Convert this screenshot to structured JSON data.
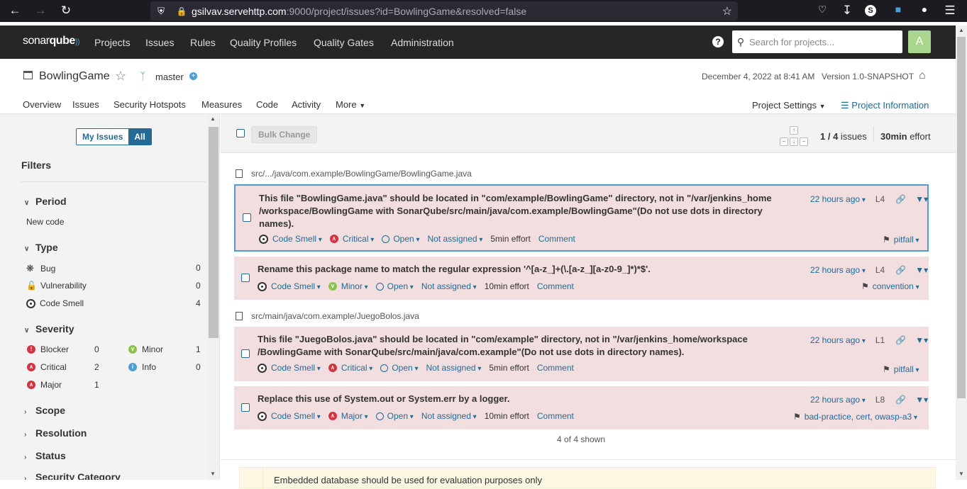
{
  "browser": {
    "host": "gsilvav.servehttp.com",
    "path": ":9000/project/issues?id=BowlingGame&resolved=false"
  },
  "nav": {
    "logo_a": "sonar",
    "logo_b": "qube",
    "items": [
      "Projects",
      "Issues",
      "Rules",
      "Quality Profiles",
      "Quality Gates",
      "Administration"
    ],
    "help": "?",
    "search_placeholder": "Search for projects...",
    "avatar": "A"
  },
  "project": {
    "name": "BowlingGame",
    "branch": "master",
    "analysis_date": "December 4, 2022 at 8:41 AM",
    "version": "Version 1.0-SNAPSHOT",
    "tabs": [
      "Overview",
      "Issues",
      "Security Hotspots",
      "Measures",
      "Code",
      "Activity",
      "More"
    ],
    "settings": "Project Settings",
    "info": "Project Information"
  },
  "sidebar": {
    "my_issues": "My Issues",
    "all": "All",
    "filters_title": "Filters",
    "period": {
      "title": "Period",
      "value": "New code"
    },
    "type": {
      "title": "Type",
      "items": [
        {
          "label": "Bug",
          "count": "0"
        },
        {
          "label": "Vulnerability",
          "count": "0"
        },
        {
          "label": "Code Smell",
          "count": "4"
        }
      ]
    },
    "severity": {
      "title": "Severity",
      "items": [
        {
          "label": "Blocker",
          "count": "0",
          "color": "#d4333f"
        },
        {
          "label": "Minor",
          "count": "1",
          "color": "#8bc34a"
        },
        {
          "label": "Critical",
          "count": "2",
          "color": "#d4333f"
        },
        {
          "label": "Info",
          "count": "0",
          "color": "#4b9fd5"
        },
        {
          "label": "Major",
          "count": "1",
          "color": "#d4333f"
        }
      ]
    },
    "sections": [
      "Scope",
      "Resolution",
      "Status",
      "Security Category"
    ]
  },
  "toolbar": {
    "bulk_change": "Bulk Change",
    "position": "1 / 4",
    "issues_word": "issues",
    "effort": "30min",
    "effort_word": "effort"
  },
  "files": [
    "src/.../java/com.example/BowlingGame/BowlingGame.java",
    "src/main/java/com.example/JuegoBolos.java"
  ],
  "issues": [
    {
      "message": "This file \"BowlingGame.java\" should be located in \"com/example/BowlingGame\" directory, not in \"/var/jenkins_home /workspace/BowlingGame with SonarQube/src/main/java/com.example/BowlingGame\"(Do not use dots in directory names).",
      "type": "Code Smell",
      "severity": "Critical",
      "status": "Open",
      "assignee": "Not assigned",
      "effort": "5min effort",
      "comment": "Comment",
      "age": "22 hours ago",
      "line": "L4",
      "tags": "pitfall"
    },
    {
      "message": "Rename this package name to match the regular expression '^[a-z_]+(\\.[a-z_][a-z0-9_]*)*$'.",
      "type": "Code Smell",
      "severity": "Minor",
      "status": "Open",
      "assignee": "Not assigned",
      "effort": "10min effort",
      "comment": "Comment",
      "age": "22 hours ago",
      "line": "L4",
      "tags": "convention"
    },
    {
      "message": "This file \"JuegoBolos.java\" should be located in \"com/example\" directory, not in \"/var/jenkins_home/workspace /BowlingGame with SonarQube/src/main/java/com.example\"(Do not use dots in directory names).",
      "type": "Code Smell",
      "severity": "Critical",
      "status": "Open",
      "assignee": "Not assigned",
      "effort": "5min effort",
      "comment": "Comment",
      "age": "22 hours ago",
      "line": "L1",
      "tags": "pitfall"
    },
    {
      "message": "Replace this use of System.out or System.err by a logger.",
      "type": "Code Smell",
      "severity": "Major",
      "status": "Open",
      "assignee": "Not assigned",
      "effort": "10min effort",
      "comment": "Comment",
      "age": "22 hours ago",
      "line": "L8",
      "tags": "bad-practice, cert, owasp-a3"
    }
  ],
  "shown": "4 of 4 shown",
  "footer_warning": "Embedded database should be used for evaluation purposes only"
}
